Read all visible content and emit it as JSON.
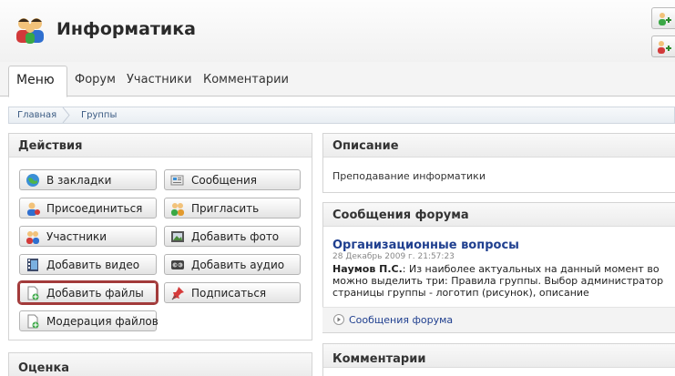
{
  "header": {
    "title": "Информатика"
  },
  "tabs": [
    {
      "label": "Меню"
    },
    {
      "label": "Форум"
    },
    {
      "label": "Участники"
    },
    {
      "label": "Комментарии"
    }
  ],
  "breadcrumb": [
    "Главная",
    "Группы"
  ],
  "actions": {
    "title": "Действия",
    "buttons": [
      {
        "label": "В закладки",
        "icon": "globe-icon"
      },
      {
        "label": "Сообщения",
        "icon": "message-icon"
      },
      {
        "label": "Присоединиться",
        "icon": "user-join-icon"
      },
      {
        "label": "Пригласить",
        "icon": "invite-icon"
      },
      {
        "label": "Участники",
        "icon": "members-icon"
      },
      {
        "label": "Добавить фото",
        "icon": "photo-icon"
      },
      {
        "label": "Добавить видео",
        "icon": "video-icon"
      },
      {
        "label": "Добавить аудио",
        "icon": "audio-icon"
      },
      {
        "label": "Добавить файлы",
        "icon": "add-file-icon"
      },
      {
        "label": "Подписаться",
        "icon": "pin-icon"
      },
      {
        "label": "Модерация файлов",
        "icon": "file-moderation-icon"
      }
    ]
  },
  "rating": {
    "title": "Оценка"
  },
  "description": {
    "title": "Описание",
    "text": "Преподавание информатики"
  },
  "forum": {
    "title": "Сообщения форума",
    "topic": "Организационные вопросы",
    "date": "28 Декабрь 2009 г. 21:57:23",
    "author": "Наумов П.С.",
    "line1": ": Из наиболее актуальных на данный момент во",
    "line2": "можно выделить три: Правила группы. Выбор администратор",
    "line3": "страницы группы - логотип (рисунок), описание",
    "more": "Сообщения форума"
  },
  "comments": {
    "title": "Комментарии"
  }
}
